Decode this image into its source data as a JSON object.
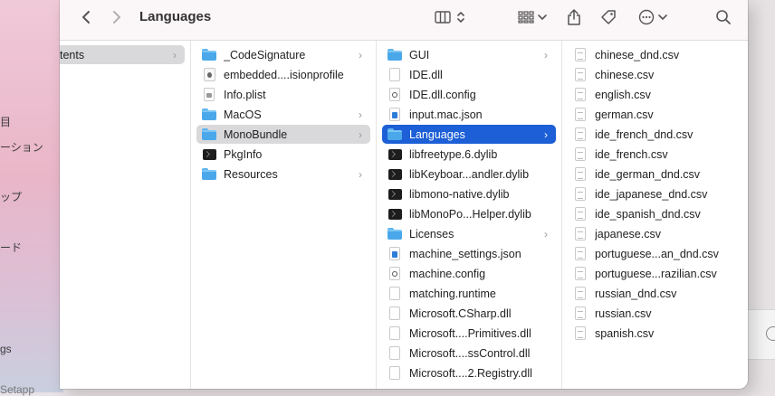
{
  "window": {
    "title": "Languages"
  },
  "behind_sidebar": {
    "items": [
      "目",
      "ーション",
      "ップ",
      "ード",
      "gs",
      "Setapp"
    ]
  },
  "toolbar": {
    "back": "back",
    "forward": "forward",
    "view": "column view",
    "group": "group",
    "share": "share",
    "tags": "tags",
    "more": "more",
    "search": "search"
  },
  "columns": [
    {
      "items": [
        {
          "label": "tents",
          "icon": "none",
          "chevron": true,
          "selected": "gray"
        }
      ]
    },
    {
      "items": [
        {
          "label": "_CodeSignature",
          "icon": "folder",
          "chevron": true
        },
        {
          "label": "embedded....isionprofile",
          "icon": "profile"
        },
        {
          "label": "Info.plist",
          "icon": "plist"
        },
        {
          "label": "MacOS",
          "icon": "folder",
          "chevron": true
        },
        {
          "label": "MonoBundle",
          "icon": "folder",
          "chevron": true,
          "selected": "gray"
        },
        {
          "label": "PkgInfo",
          "icon": "terminal"
        },
        {
          "label": "Resources",
          "icon": "folder",
          "chevron": true
        }
      ]
    },
    {
      "items": [
        {
          "label": "GUI",
          "icon": "folder",
          "chevron": true
        },
        {
          "label": "IDE.dll",
          "icon": "doc"
        },
        {
          "label": "IDE.dll.config",
          "icon": "gear"
        },
        {
          "label": "input.mac.json",
          "icon": "badge"
        },
        {
          "label": "Languages",
          "icon": "folder",
          "chevron": true,
          "selected": "blue"
        },
        {
          "label": "libfreetype.6.dylib",
          "icon": "terminal"
        },
        {
          "label": "libKeyboar...andler.dylib",
          "icon": "terminal"
        },
        {
          "label": "libmono-native.dylib",
          "icon": "terminal"
        },
        {
          "label": "libMonoPo...Helper.dylib",
          "icon": "terminal"
        },
        {
          "label": "Licenses",
          "icon": "folder",
          "chevron": true
        },
        {
          "label": "machine_settings.json",
          "icon": "badge"
        },
        {
          "label": "machine.config",
          "icon": "gear"
        },
        {
          "label": "matching.runtime",
          "icon": "doc"
        },
        {
          "label": "Microsoft.CSharp.dll",
          "icon": "doc"
        },
        {
          "label": "Microsoft....Primitives.dll",
          "icon": "doc"
        },
        {
          "label": "Microsoft....ssControl.dll",
          "icon": "doc"
        },
        {
          "label": "Microsoft....2.Registry.dll",
          "icon": "doc"
        }
      ]
    },
    {
      "items": [
        {
          "label": "chinese_dnd.csv",
          "icon": "doc-lines"
        },
        {
          "label": "chinese.csv",
          "icon": "doc-lines"
        },
        {
          "label": "english.csv",
          "icon": "doc-lines"
        },
        {
          "label": "german.csv",
          "icon": "doc-lines"
        },
        {
          "label": "ide_french_dnd.csv",
          "icon": "doc-lines"
        },
        {
          "label": "ide_french.csv",
          "icon": "doc-lines"
        },
        {
          "label": "ide_german_dnd.csv",
          "icon": "doc-lines"
        },
        {
          "label": "ide_japanese_dnd.csv",
          "icon": "doc-lines"
        },
        {
          "label": "ide_spanish_dnd.csv",
          "icon": "doc-lines"
        },
        {
          "label": "japanese.csv",
          "icon": "doc-lines"
        },
        {
          "label": "portuguese...an_dnd.csv",
          "icon": "doc-lines"
        },
        {
          "label": "portuguese...razilian.csv",
          "icon": "doc-lines"
        },
        {
          "label": "russian_dnd.csv",
          "icon": "doc-lines"
        },
        {
          "label": "russian.csv",
          "icon": "doc-lines"
        },
        {
          "label": "spanish.csv",
          "icon": "doc-lines"
        }
      ]
    }
  ]
}
